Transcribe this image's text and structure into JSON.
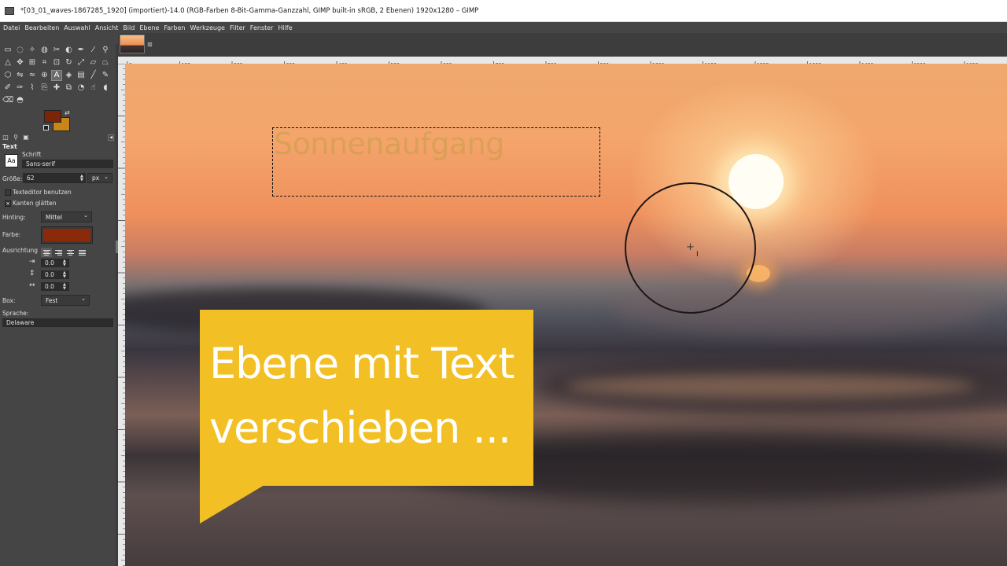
{
  "window": {
    "title": "*[03_01_waves-1867285_1920] (importiert)-14.0 (RGB-Farben 8-Bit-Gamma-Ganzzahl, GIMP built-in sRGB, 2 Ebenen) 1920x1280 – GIMP"
  },
  "menu": [
    "Datei",
    "Bearbeiten",
    "Auswahl",
    "Ansicht",
    "Bild",
    "Ebene",
    "Farben",
    "Werkzeuge",
    "Filter",
    "Fenster",
    "Hilfe"
  ],
  "toolbox": {
    "icons": [
      "rect-select-icon",
      "free-select-icon",
      "fuzzy-select-icon",
      "color-select-icon",
      "scissors-select-icon",
      "foreground-select-icon",
      "paths-icon",
      "color-picker-icon",
      "zoom-icon",
      "measure-icon",
      "move-icon",
      "align-icon",
      "crop-icon",
      "unified-transform-icon",
      "rotate-icon",
      "scale-icon",
      "shear-icon",
      "perspective-icon",
      "cage-transform-icon",
      "flip-icon",
      "warp-transform-icon",
      "handle-transform-icon",
      "text-tool-icon",
      "bucket-fill-icon",
      "blend-icon",
      "paintbrush-icon",
      "pencil-icon",
      "airbrush-icon",
      "ink-icon",
      "mypaint-brush-icon",
      "clone-icon",
      "heal-icon",
      "perspective-clone-icon",
      "blur-sharpen-icon",
      "smudge-icon",
      "dodge-burn-icon",
      "eraser-icon",
      "dodge-icon"
    ],
    "active": "text-tool-icon",
    "fg_color": "#7a2508",
    "bg_color": "#c8861a"
  },
  "tool_options": {
    "title": "Text",
    "font_label": "Schrift",
    "font_icon": "Aa",
    "font_value": "Sans-serif",
    "size_label": "Größe:",
    "size_value": "62",
    "size_unit": "px",
    "use_editor_label": "Texteditor benutzen",
    "antialias_label": "Kanten glätten",
    "antialias_checked": true,
    "hinting_label": "Hinting:",
    "hinting_value": "Mittel",
    "color_label": "Farbe:",
    "text_color": "#8b2a0a",
    "justify_label": "Ausrichtung",
    "indent_value": "0.0",
    "line_spacing_value": "0.0",
    "letter_spacing_value": "0.0",
    "box_label": "Box:",
    "box_value": "Fest",
    "language_label": "Sprache:",
    "language_value": "Delaware"
  },
  "ruler": {
    "marks": [
      "0",
      "100",
      "200",
      "300",
      "400",
      "500",
      "600",
      "700",
      "800",
      "900",
      "1000",
      "1100",
      "1200",
      "1300",
      "1400",
      "1500",
      "1600"
    ]
  },
  "canvas": {
    "layer_text": "Sonnenaufgang",
    "callout_line1": "Ebene mit Text",
    "callout_line2": "verschieben ...",
    "callout_color": "#f2bf25"
  }
}
